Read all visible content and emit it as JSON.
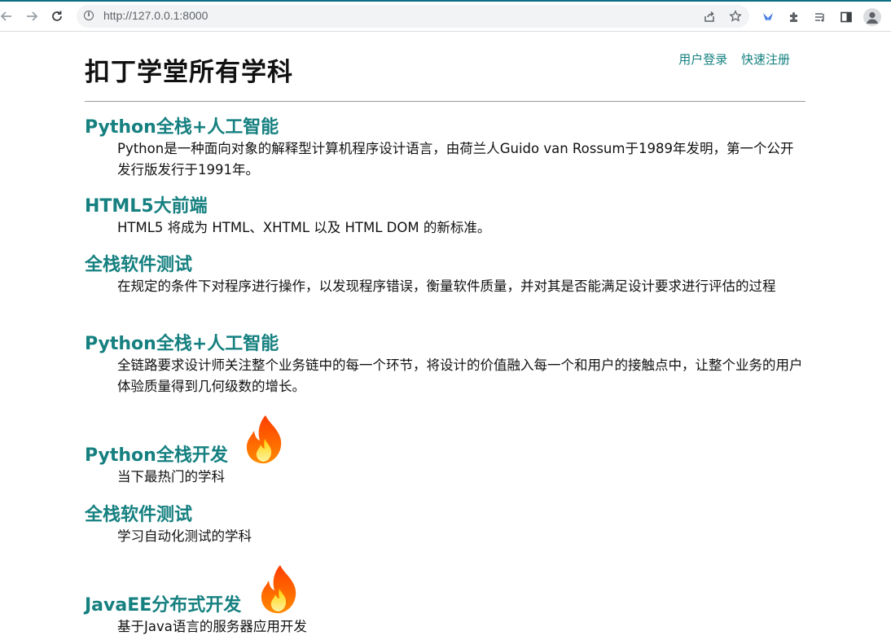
{
  "browser": {
    "url": "http://127.0.0.1:8000"
  },
  "header": {
    "title": "扣丁学堂所有学科",
    "login_link": "用户登录",
    "register_link": "快速注册"
  },
  "courses": [
    {
      "title": "Python全栈+人工智能",
      "description": "Python是一种面向对象的解释型计算机程序设计语言，由荷兰人Guido van Rossum于1989年发明，第一个公开发行版发行于1991年。"
    },
    {
      "title": "HTML5大前端",
      "description": "HTML5 将成为 HTML、XHTML 以及 HTML DOM 的新标准。"
    },
    {
      "title": "全栈软件测试",
      "description": "在规定的条件下对程序进行操作，以发现程序错误，衡量软件质量，并对其是否能满足设计要求进行评估的过程"
    },
    {
      "title": "Python全栈+人工智能",
      "description": "全链路要求设计师关注整个业务链中的每一个环节，将设计的价值融入每一个和用户的接触点中，让整个业务的用户体验质量得到几何级数的增长。"
    },
    {
      "title": "Python全栈开发",
      "description": "当下最热门的学科",
      "hot": true
    },
    {
      "title": "全栈软件测试",
      "description": "学习自动化测试的学科"
    },
    {
      "title": "JavaEE分布式开发",
      "description": "基于Java语言的服务器应用开发",
      "hot": true
    }
  ],
  "icons": {
    "hot": "flame-icon"
  },
  "colors": {
    "link": "#168080",
    "text": "#111111",
    "divider": "#9b9b9b",
    "flame_outer": "#ff5a00",
    "flame_inner": "#ffc400"
  }
}
